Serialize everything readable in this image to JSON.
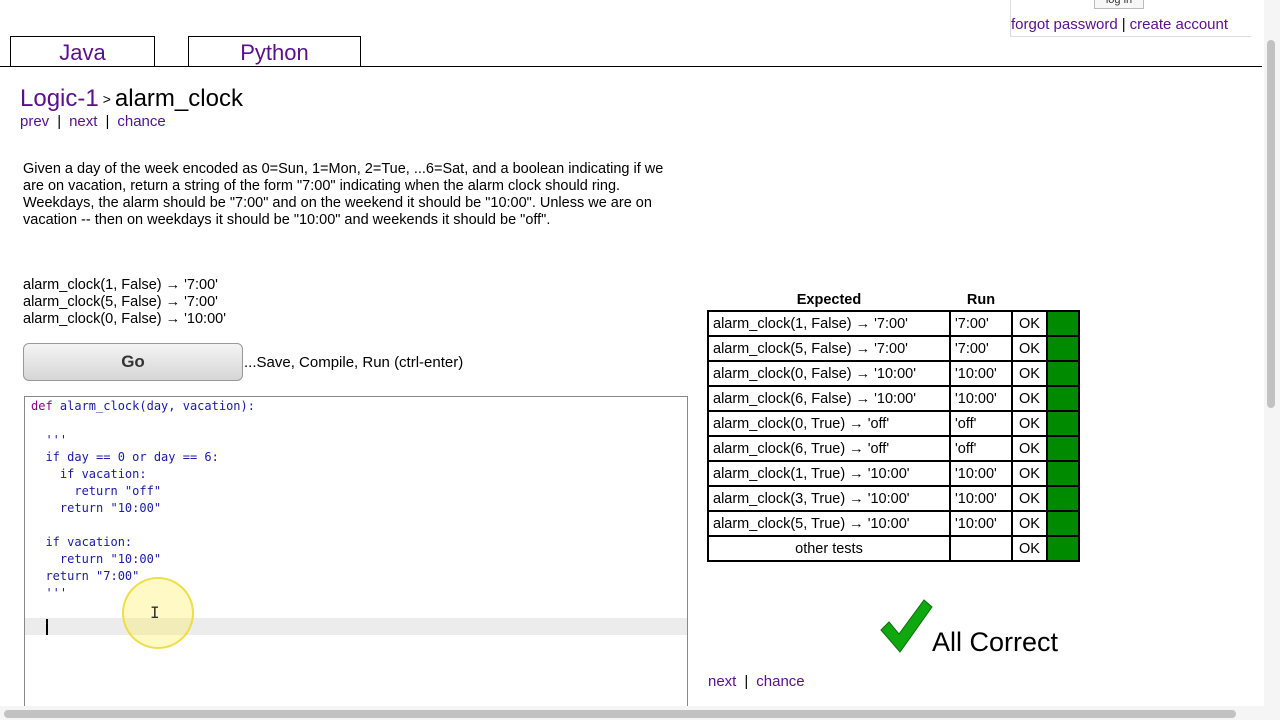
{
  "account": {
    "login_label": "log in",
    "forgot_password": "forgot password",
    "create_account": "create account",
    "separator": "|"
  },
  "tabs": [
    {
      "label": "Java",
      "active": false
    },
    {
      "label": "Python",
      "active": true
    }
  ],
  "breadcrumb": {
    "section": "Logic-1",
    "arrow": ">",
    "problem": "alarm_clock"
  },
  "nav": {
    "prev": "prev",
    "next": "next",
    "chance": "chance",
    "separator": "|"
  },
  "problem": {
    "description": "Given a day of the week encoded as 0=Sun, 1=Mon, 2=Tue, ...6=Sat, and a boolean indicating if we are on vacation, return a string of the form \"7:00\" indicating when the alarm clock should ring. Weekdays, the alarm should be \"7:00\" and on the weekend it should be \"10:00\". Unless we are on vacation -- then on weekdays it should be \"10:00\" and weekends it should be \"off\".",
    "examples": [
      "alarm_clock(1, False) → '7:00'",
      "alarm_clock(5, False) → '7:00'",
      "alarm_clock(0, False) → '10:00'"
    ]
  },
  "go": {
    "label": "Go",
    "hint": "...Save, Compile, Run (ctrl-enter)"
  },
  "editor": {
    "lines": [
      {
        "kw": "def",
        "text": " alarm_clock(day, vacation):"
      },
      {
        "kw": "",
        "text": ""
      },
      {
        "kw": "",
        "text": "  '''"
      },
      {
        "kw": "",
        "text": "  if day == 0 or day == 6:"
      },
      {
        "kw": "",
        "text": "    if vacation:"
      },
      {
        "kw": "",
        "text": "      return \"off\""
      },
      {
        "kw": "",
        "text": "    return \"10:00\""
      },
      {
        "kw": "",
        "text": ""
      },
      {
        "kw": "",
        "text": "  if vacation:"
      },
      {
        "kw": "",
        "text": "    return \"10:00\""
      },
      {
        "kw": "",
        "text": "  return \"7:00\""
      },
      {
        "kw": "",
        "text": "  '''"
      }
    ]
  },
  "results": {
    "headers": {
      "expected": "Expected",
      "run": "Run"
    },
    "rows": [
      {
        "expected": "alarm_clock(1, False) → '7:00'",
        "run": "'7:00'",
        "status": "OK"
      },
      {
        "expected": "alarm_clock(5, False) → '7:00'",
        "run": "'7:00'",
        "status": "OK"
      },
      {
        "expected": "alarm_clock(0, False) → '10:00'",
        "run": "'10:00'",
        "status": "OK"
      },
      {
        "expected": "alarm_clock(6, False) → '10:00'",
        "run": "'10:00'",
        "status": "OK"
      },
      {
        "expected": "alarm_clock(0, True) → 'off'",
        "run": "'off'",
        "status": "OK"
      },
      {
        "expected": "alarm_clock(6, True) → 'off'",
        "run": "'off'",
        "status": "OK"
      },
      {
        "expected": "alarm_clock(1, True) → '10:00'",
        "run": "'10:00'",
        "status": "OK"
      },
      {
        "expected": "alarm_clock(3, True) → '10:00'",
        "run": "'10:00'",
        "status": "OK"
      },
      {
        "expected": "alarm_clock(5, True) → '10:00'",
        "run": "'10:00'",
        "status": "OK"
      },
      {
        "expected": "other tests",
        "run": "",
        "status": "OK"
      }
    ],
    "pass_color": "#008a00"
  },
  "summary": {
    "text": "All Correct",
    "icon": "checkmark-icon",
    "icon_color": "#0fa80f"
  },
  "bottom_nav": {
    "next": "next",
    "chance": "chance",
    "separator": "|"
  },
  "colors": {
    "link": "#5a0f8c",
    "code": "#1a1aa6",
    "keyword": "#8b008b"
  }
}
